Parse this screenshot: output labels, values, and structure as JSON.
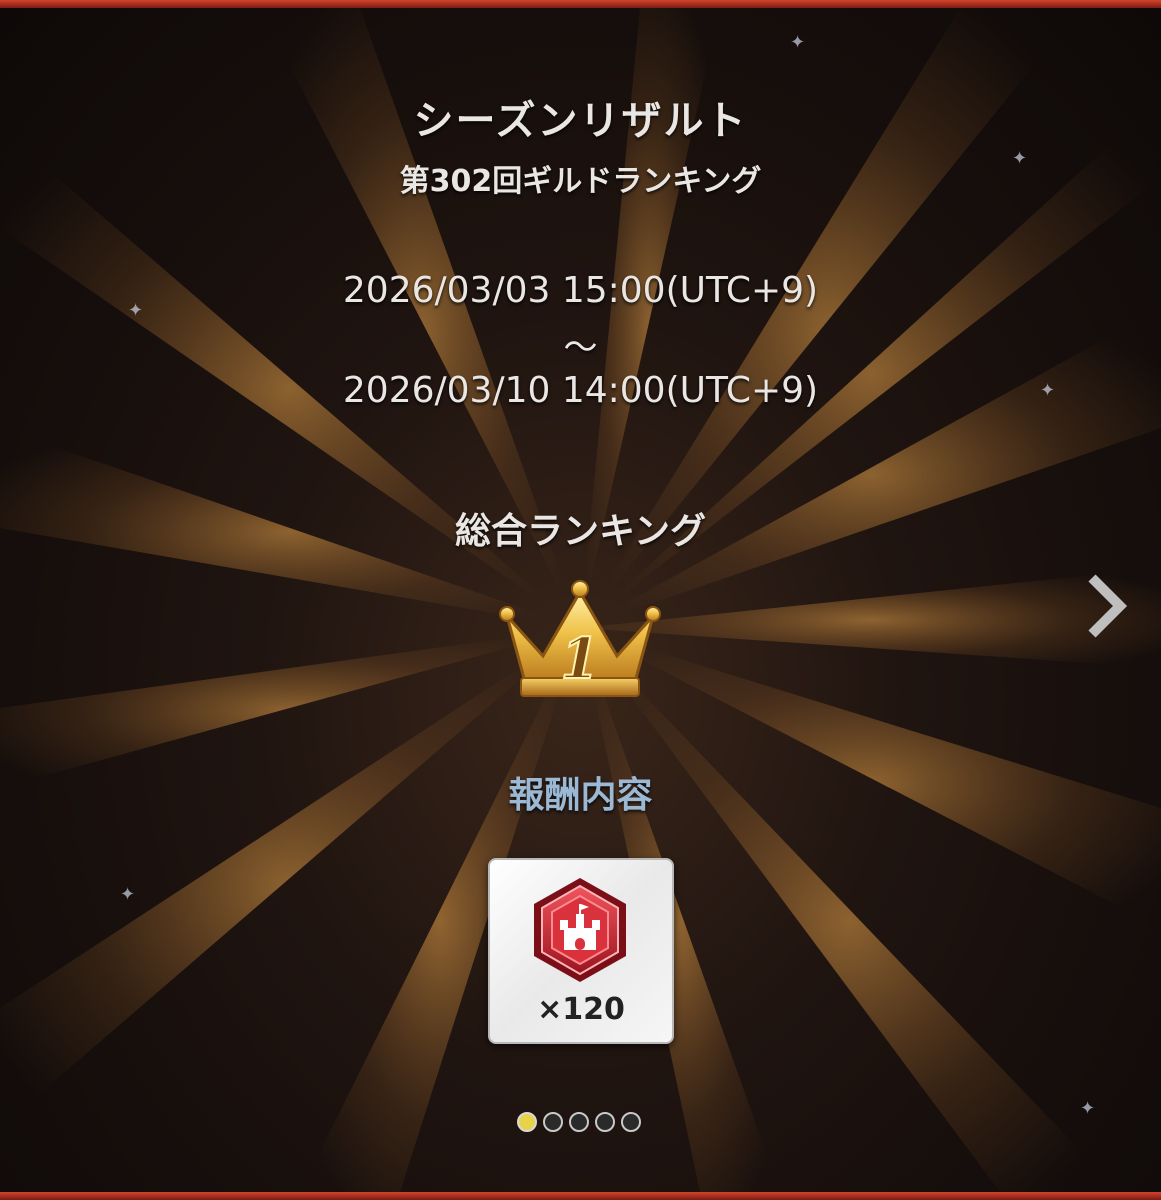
{
  "header": {
    "title": "シーズンリザルト",
    "subtitle": "第302回ギルドランキング"
  },
  "period": {
    "start": "2026/03/03 15:00(UTC+9)",
    "separator": "〜",
    "end": "2026/03/10 14:00(UTC+9)"
  },
  "ranking": {
    "label": "総合ランキング",
    "rank": "1"
  },
  "reward": {
    "label": "報酬内容",
    "count": "×120",
    "icon": "castle-medal-icon"
  },
  "pager": {
    "total": 5,
    "active": 0
  },
  "colors": {
    "frame": "#d4432c",
    "gold": "#e8b63a",
    "reward_label": "#9bb8d4",
    "medal_red": "#c62a32",
    "active_dot": "#e8d24a"
  }
}
